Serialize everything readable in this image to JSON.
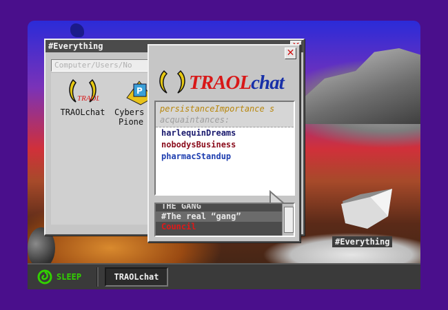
{
  "explorer": {
    "title": "#Everything",
    "address": "Computer/Users/No",
    "files": [
      {
        "label": "TRAOLchat",
        "icon": "traolchat-app-icon"
      },
      {
        "label": "Cybers",
        "label2": "Pione",
        "icon": "cyberspace-pioneer-icon"
      }
    ]
  },
  "chat": {
    "brand_traol": "TRAOL",
    "brand_chat": "chat",
    "contacts_header": "persistanceImportance",
    "contacts_header_suffix": "s",
    "contacts_subheader": "acquaintances:",
    "contacts": [
      {
        "name": "harlequinDreams",
        "color": "#1a1a6e"
      },
      {
        "name": "nobodysBusiness",
        "color": "#8b0d1c"
      },
      {
        "name": "pharmacStandup",
        "color": "#1f3fb0"
      }
    ],
    "channels": [
      "THE GANG",
      "#The real “gang”",
      "Council"
    ]
  },
  "desktop": {
    "folder_label": "#Everything"
  },
  "taskbar": {
    "sleep_label": "SLEEP",
    "task_label": "TRAOLchat"
  },
  "colors": {
    "desktop_bg": "#4a0f8c",
    "brand_red": "#d81818",
    "brand_blue": "#1830a8",
    "sleep_green": "#32d000"
  }
}
